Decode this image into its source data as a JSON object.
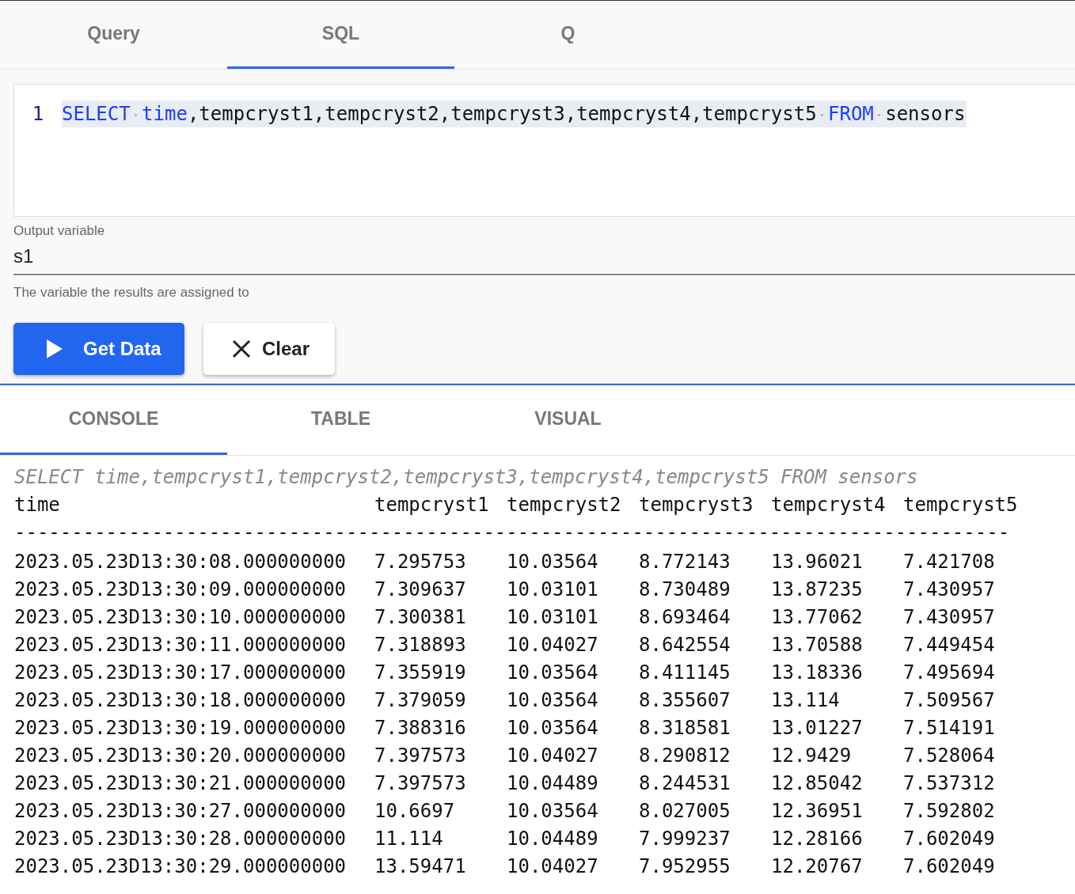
{
  "query_tabs": [
    {
      "label": "Query",
      "selected": false
    },
    {
      "label": "SQL",
      "selected": true
    },
    {
      "label": "Q",
      "selected": false
    }
  ],
  "editor": {
    "line_number": "1",
    "code": [
      {
        "text": "SELECT",
        "kind": "keyword"
      },
      {
        "text": "time",
        "kind": "keyword"
      },
      {
        "text": ",tempcryst1,tempcryst2,tempcryst3,tempcryst4,tempcryst5",
        "kind": "plain"
      },
      {
        "text": "FROM",
        "kind": "keyword"
      },
      {
        "text": "sensors",
        "kind": "plain"
      }
    ]
  },
  "output_variable": {
    "label": "Output variable",
    "value": "s1",
    "helper": "The variable the results are assigned to"
  },
  "buttons": [
    {
      "label": "Get Data",
      "kind": "primary"
    },
    {
      "label": "Clear",
      "kind": "secondary"
    }
  ],
  "result_tabs": [
    {
      "label": "CONSOLE",
      "selected": true
    },
    {
      "label": "TABLE",
      "selected": false
    },
    {
      "label": "VISUAL",
      "selected": false
    }
  ],
  "console": {
    "echo": "SELECT time,tempcryst1,tempcryst2,tempcryst3,tempcryst4,tempcryst5 FROM sensors",
    "columns": [
      "time",
      "tempcryst1",
      "tempcryst2",
      "tempcryst3",
      "tempcryst4",
      "tempcryst5"
    ],
    "separator": "---------------------------------------------------------------------------------------",
    "rows": [
      [
        "2023.05.23D13:30:08.000000000",
        "7.295753",
        "10.03564",
        "8.772143",
        "13.96021",
        "7.421708"
      ],
      [
        "2023.05.23D13:30:09.000000000",
        "7.309637",
        "10.03101",
        "8.730489",
        "13.87235",
        "7.430957"
      ],
      [
        "2023.05.23D13:30:10.000000000",
        "7.300381",
        "10.03101",
        "8.693464",
        "13.77062",
        "7.430957"
      ],
      [
        "2023.05.23D13:30:11.000000000",
        "7.318893",
        "10.04027",
        "8.642554",
        "13.70588",
        "7.449454"
      ],
      [
        "2023.05.23D13:30:17.000000000",
        "7.355919",
        "10.03564",
        "8.411145",
        "13.18336",
        "7.495694"
      ],
      [
        "2023.05.23D13:30:18.000000000",
        "7.379059",
        "10.03564",
        "8.355607",
        "13.114",
        "7.509567"
      ],
      [
        "2023.05.23D13:30:19.000000000",
        "7.388316",
        "10.03564",
        "8.318581",
        "13.01227",
        "7.514191"
      ],
      [
        "2023.05.23D13:30:20.000000000",
        "7.397573",
        "10.04027",
        "8.290812",
        "12.9429",
        "7.528064"
      ],
      [
        "2023.05.23D13:30:21.000000000",
        "7.397573",
        "10.04489",
        "8.244531",
        "12.85042",
        "7.537312"
      ],
      [
        "2023.05.23D13:30:27.000000000",
        "10.6697",
        "10.03564",
        "8.027005",
        "12.36951",
        "7.592802"
      ],
      [
        "2023.05.23D13:30:28.000000000",
        "11.114",
        "10.04489",
        "7.999237",
        "12.28166",
        "7.602049"
      ],
      [
        "2023.05.23D13:30:29.000000000",
        "13.59471",
        "10.04027",
        "7.952955",
        "12.20767",
        "7.602049"
      ]
    ]
  }
}
